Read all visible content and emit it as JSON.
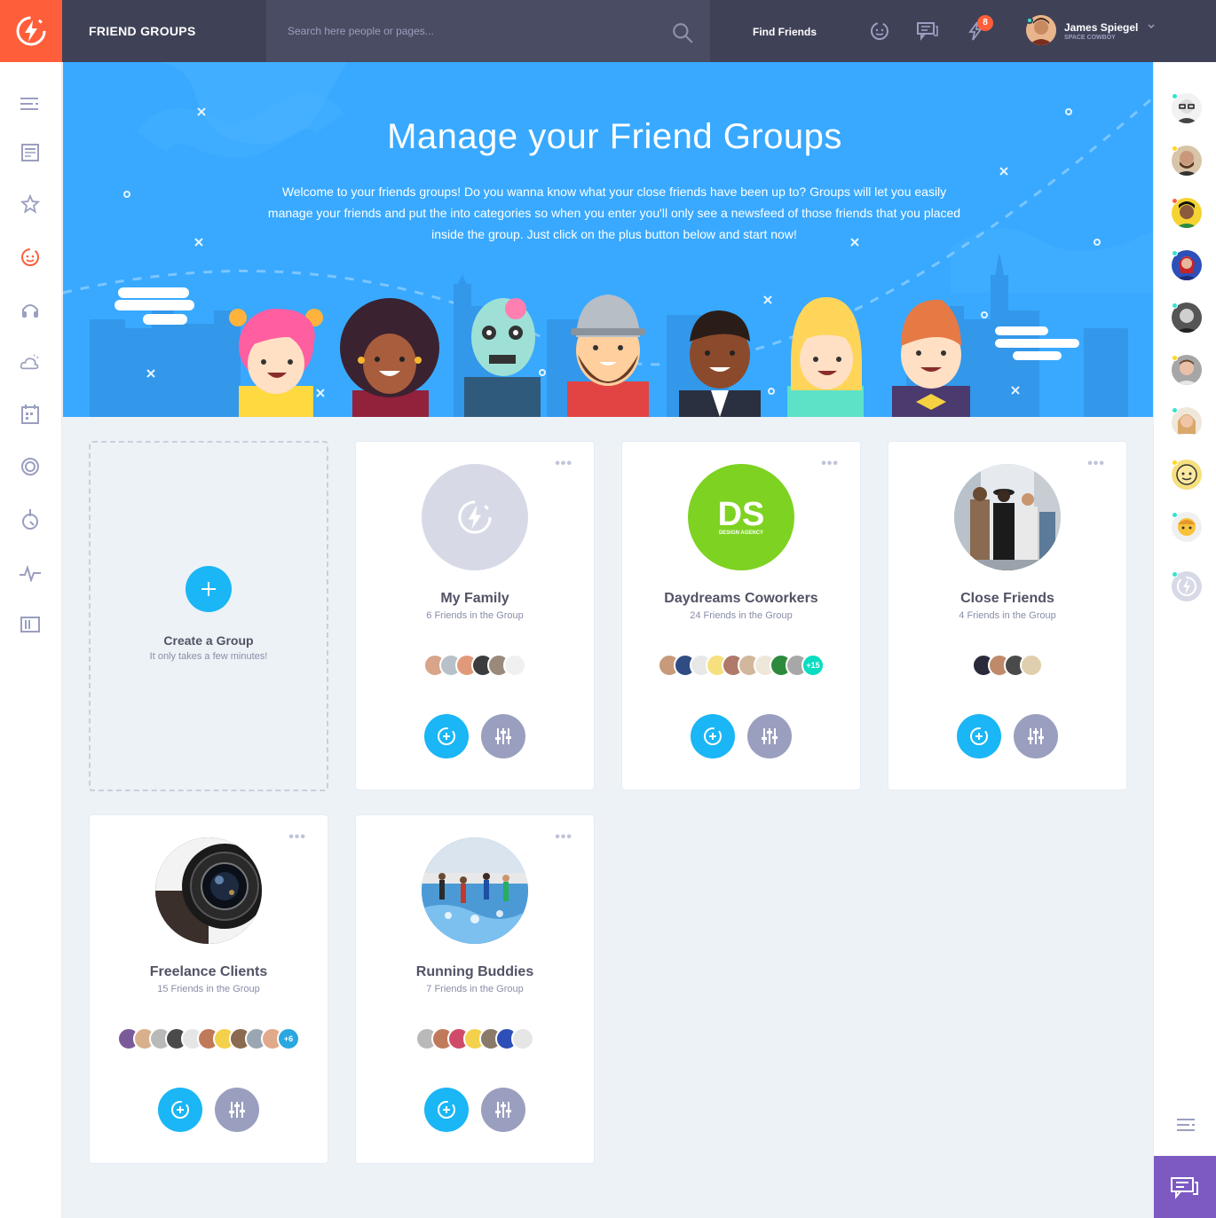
{
  "topbar": {
    "title": "FRIEND GROUPS",
    "search_placeholder": "Search here people or pages...",
    "find_friends": "Find Friends",
    "notification_count": "8",
    "user_name": "James Spiegel",
    "user_role": "SPACE COWBOY"
  },
  "banner": {
    "heading": "Manage your Friend Groups",
    "text": "Welcome to your friends groups! Do you wanna know what your close friends have been up to? Groups will let you easily manage your friends and put the into categories so when you enter you'll only see a newsfeed of those friends that you placed inside the group. Just click on the plus button below and start now!"
  },
  "create": {
    "title": "Create a Group",
    "subtitle": "It only takes a few minutes!"
  },
  "groups": [
    {
      "name": "My Family",
      "count": "6 Friends in the Group",
      "more": ""
    },
    {
      "name": "Daydreams Coworkers",
      "count": "24 Friends in the Group",
      "more": "+15",
      "logo_main": "DS",
      "logo_sub": "DESIGN AGENCY"
    },
    {
      "name": "Close Friends",
      "count": "4 Friends in the Group",
      "more": ""
    },
    {
      "name": "Freelance Clients",
      "count": "15 Friends in the Group",
      "more": "+6"
    },
    {
      "name": "Running Buddies",
      "count": "7 Friends in the Group",
      "more": ""
    }
  ],
  "colors": {
    "brand_orange": "#ff5e3a",
    "banner_blue": "#38a9ff",
    "button_blue": "#1ab6f5",
    "button_grey": "#9a9fbf",
    "chat_purple": "#7c5ac2",
    "online_green": "#32e4cd"
  }
}
